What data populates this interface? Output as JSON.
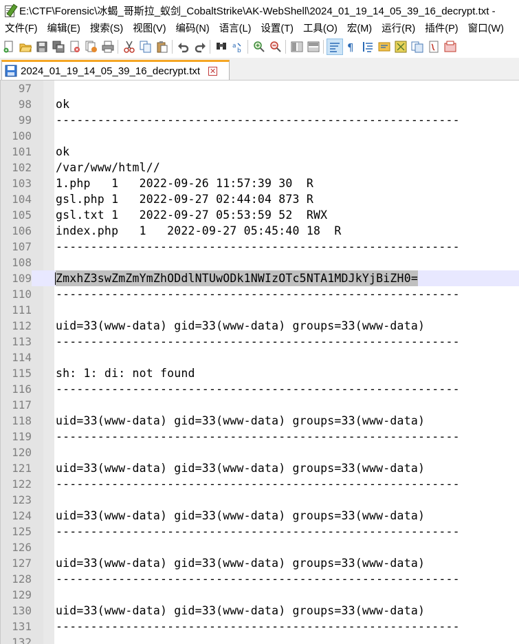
{
  "window": {
    "title": "E:\\CTF\\Forensic\\冰蝎_哥斯拉_蚁剑_CobaltStrike\\AK-WebShell\\2024_01_19_14_05_39_16_decrypt.txt - "
  },
  "menu": [
    "文件(F)",
    "编辑(E)",
    "搜索(S)",
    "视图(V)",
    "编码(N)",
    "语言(L)",
    "设置(T)",
    "工具(O)",
    "宏(M)",
    "运行(R)",
    "插件(P)",
    "窗口(W)"
  ],
  "toolbar": {
    "icons": [
      "new-file-icon",
      "open-file-icon",
      "save-icon",
      "save-all-icon",
      "close-icon",
      "close-all-icon",
      "print-icon",
      "cut-icon",
      "copy-icon",
      "paste-icon",
      "undo-icon",
      "redo-icon",
      "find-icon",
      "replace-icon",
      "zoom-in-icon",
      "zoom-out-icon",
      "sync-vertical-icon",
      "sync-horizontal-icon",
      "word-wrap-icon",
      "show-all-chars-icon",
      "indent-guide-icon",
      "doc-map-icon",
      "function-list-icon",
      "folder-workspace-icon",
      "macro-record-icon",
      "macro-playback-icon"
    ]
  },
  "tab": {
    "label": "2024_01_19_14_05_39_16_decrypt.txt",
    "close": "✕"
  },
  "editor": {
    "lines": [
      {
        "n": "97",
        "text": ""
      },
      {
        "n": "98",
        "text": "ok"
      },
      {
        "n": "99",
        "text": "----------------------------------------------------------"
      },
      {
        "n": "100",
        "text": ""
      },
      {
        "n": "101",
        "text": "ok"
      },
      {
        "n": "102",
        "text": "/var/www/html//"
      },
      {
        "n": "103",
        "text": "1.php   1   2022-09-26 11:57:39 30  R"
      },
      {
        "n": "104",
        "text": "gsl.php 1   2022-09-27 02:44:04 873 R"
      },
      {
        "n": "105",
        "text": "gsl.txt 1   2022-09-27 05:53:59 52  RWX"
      },
      {
        "n": "106",
        "text": "index.php   1   2022-09-27 05:45:40 18  R"
      },
      {
        "n": "107",
        "text": "----------------------------------------------------------"
      },
      {
        "n": "108",
        "text": ""
      },
      {
        "n": "109",
        "text": "ZmxhZ3swZmZmYmZhODdlNTUwODk1NWIzOTc5NTA1MDJkYjBiZH0=",
        "selected": true
      },
      {
        "n": "110",
        "text": "----------------------------------------------------------"
      },
      {
        "n": "111",
        "text": ""
      },
      {
        "n": "112",
        "text": "uid=33(www-data) gid=33(www-data) groups=33(www-data)"
      },
      {
        "n": "113",
        "text": "----------------------------------------------------------"
      },
      {
        "n": "114",
        "text": ""
      },
      {
        "n": "115",
        "text": "sh: 1: di: not found"
      },
      {
        "n": "116",
        "text": "----------------------------------------------------------"
      },
      {
        "n": "117",
        "text": ""
      },
      {
        "n": "118",
        "text": "uid=33(www-data) gid=33(www-data) groups=33(www-data)"
      },
      {
        "n": "119",
        "text": "----------------------------------------------------------"
      },
      {
        "n": "120",
        "text": ""
      },
      {
        "n": "121",
        "text": "uid=33(www-data) gid=33(www-data) groups=33(www-data)"
      },
      {
        "n": "122",
        "text": "----------------------------------------------------------"
      },
      {
        "n": "123",
        "text": ""
      },
      {
        "n": "124",
        "text": "uid=33(www-data) gid=33(www-data) groups=33(www-data)"
      },
      {
        "n": "125",
        "text": "----------------------------------------------------------"
      },
      {
        "n": "126",
        "text": ""
      },
      {
        "n": "127",
        "text": "uid=33(www-data) gid=33(www-data) groups=33(www-data)"
      },
      {
        "n": "128",
        "text": "----------------------------------------------------------"
      },
      {
        "n": "129",
        "text": ""
      },
      {
        "n": "130",
        "text": "uid=33(www-data) gid=33(www-data) groups=33(www-data)"
      },
      {
        "n": "131",
        "text": "----------------------------------------------------------"
      },
      {
        "n": "132",
        "text": ""
      }
    ]
  },
  "colors": {
    "current_line": "#e8e8ff",
    "selection": "#c0c0c0",
    "gutter": "#e4e4e4",
    "line_number": "#808080",
    "tab_accent": "#f5a623",
    "close_red": "#c23a3a"
  }
}
